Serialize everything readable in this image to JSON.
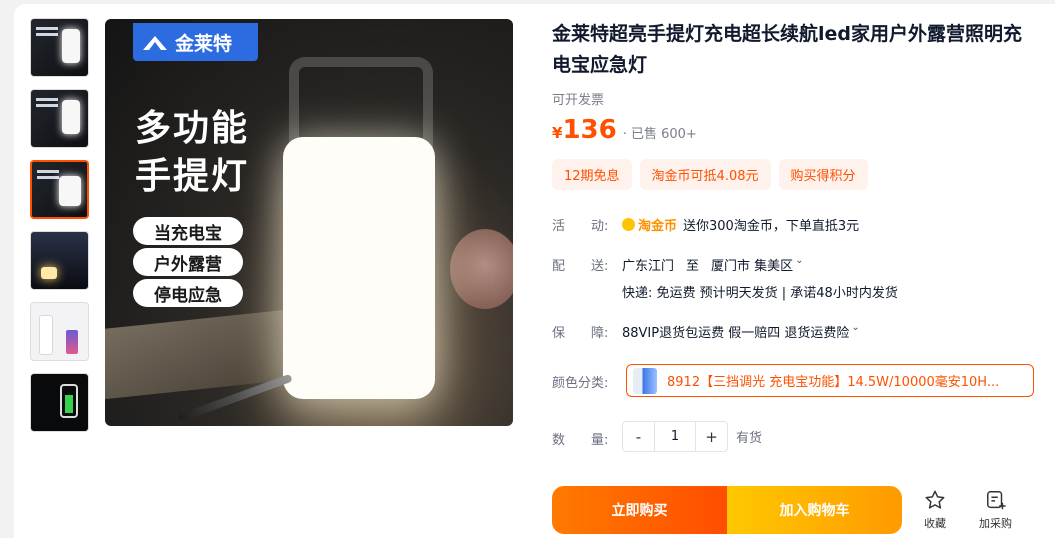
{
  "thumbnails": [
    {
      "alt": "thumb-1",
      "style": "dark"
    },
    {
      "alt": "thumb-2",
      "style": "dark"
    },
    {
      "alt": "thumb-3",
      "style": "active"
    },
    {
      "alt": "thumb-4",
      "style": "night"
    },
    {
      "alt": "thumb-5",
      "style": "white"
    },
    {
      "alt": "thumb-6",
      "style": "black"
    }
  ],
  "main_image": {
    "brand": "金莱特",
    "headline_1": "多功能",
    "headline_2": "手提灯",
    "pills": [
      "当充电宝",
      "户外露营",
      "停电应急"
    ]
  },
  "product": {
    "title": "金莱特超亮手提灯充电超长续航led家用户外露营照明充电宝应急灯",
    "invoice": "可开发票",
    "currency": "¥",
    "price": "136",
    "sold": "· 已售 600+",
    "tags": [
      "12期免息",
      "淘金币可抵4.08元",
      "购买得积分"
    ]
  },
  "activity": {
    "label": "活　　动:",
    "coin_name": "淘金币",
    "text": "送你300淘金币，下单直抵3元"
  },
  "delivery": {
    "label": "配　　送:",
    "from": "广东江门",
    "to_word": "至",
    "dest": "厦门市 集美区",
    "line2": "快递: 免运费  预计明天发货 | 承诺48小时内发货"
  },
  "guarantee": {
    "label": "保　　障:",
    "text": "88VIP退货包运费 假一赔四 退货运费险"
  },
  "color": {
    "label": "颜色分类:",
    "selected": "8912【三挡调光 充电宝功能】14.5W/10000毫安10H..."
  },
  "quantity": {
    "label": "数　　量:",
    "minus": "-",
    "value": "1",
    "plus": "+",
    "stock": "有货"
  },
  "actions": {
    "buy_now": "立即购买",
    "add_cart": "加入购物车",
    "favorite": "收藏",
    "purchase_list": "加采购"
  },
  "colors": {
    "accent": "#ff5000",
    "cart": "#ffb000"
  }
}
